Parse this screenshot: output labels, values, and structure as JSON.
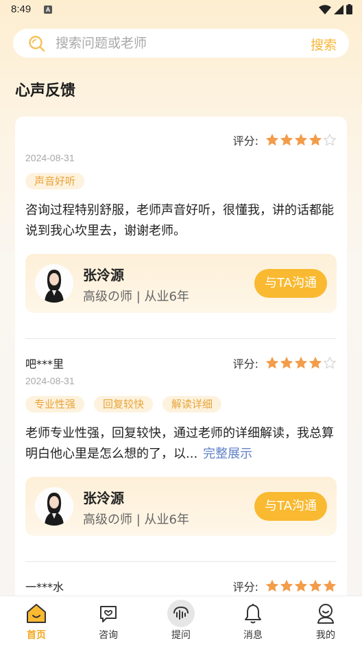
{
  "status_bar": {
    "time": "8:49",
    "notification_icon": "a-badge-icon",
    "icons": [
      "wifi-icon",
      "signal-icon",
      "battery-icon"
    ]
  },
  "search": {
    "placeholder": "搜索问题或老师",
    "button_label": "搜索"
  },
  "section": {
    "title": "心声反馈"
  },
  "rating_label": "评分:",
  "reviews": [
    {
      "user": "",
      "stars": 4,
      "date": "2024-08-31",
      "tags": [
        "声音好听"
      ],
      "text": "咨询过程特别舒服，老师声音好听，很懂我，讲的话都能说到我心坎里去，谢谢老师。",
      "expand_label": "",
      "counselor": {
        "name": "张泠源",
        "title": "高级の师 | 从业6年",
        "button_label": "与TA沟通"
      }
    },
    {
      "user": "吧***里",
      "stars": 4,
      "date": "2024-08-31",
      "tags": [
        "专业性强",
        "回复较快",
        "解读详细"
      ],
      "text": "老师专业性强，回复较快，通过老师的详细解读，我总算明白他心里是怎么想的了，以...",
      "expand_label": "完整展示",
      "counselor": {
        "name": "张泠源",
        "title": "高级の师 | 从业6年",
        "button_label": "与TA沟通"
      }
    },
    {
      "user": "一***水",
      "stars": 5
    }
  ],
  "tab_bar": [
    {
      "label": "首页",
      "icon": "home-icon",
      "active": true
    },
    {
      "label": "咨询",
      "icon": "chat-bubble-icon",
      "active": false
    },
    {
      "label": "提问",
      "icon": "voice-wave-icon",
      "active": false
    },
    {
      "label": "消息",
      "icon": "bell-icon",
      "active": false
    },
    {
      "label": "我的",
      "icon": "profile-icon",
      "active": false
    }
  ],
  "colors": {
    "accent": "#f9b930",
    "star": "#f39c4a",
    "tag_text": "#e8a43a",
    "link": "#5f7fc8"
  }
}
